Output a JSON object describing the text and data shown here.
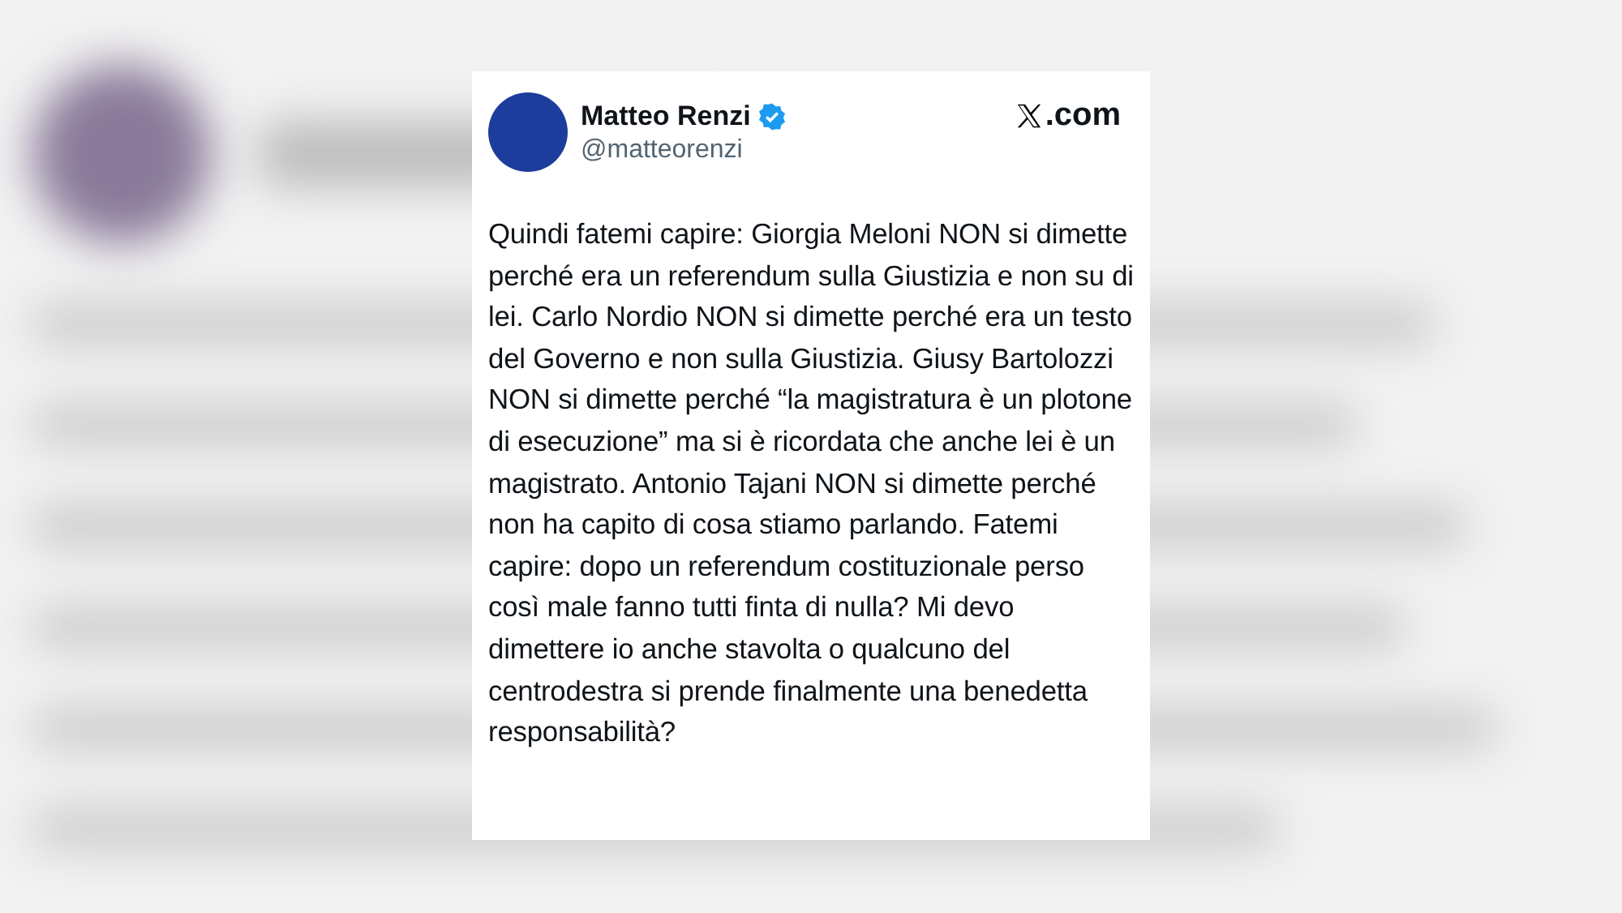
{
  "tweet": {
    "name": "Matteo Renzi",
    "verified": true,
    "handle": "@matteorenzi",
    "site": ".com",
    "text": "Quindi fatemi capire: Giorgia Meloni NON si dimette perché era un referendum sulla Giustizia e non su di lei. Carlo Nordio NON si dimette perché era un testo del Governo e non sulla Giustizia. Giusy Bartolozzi NON si dimette perché “la magistratura è un plotone di esecuzione” ma si è ricordata che anche lei è un magistrato. Antonio Tajani NON si dimette perché non ha capito di cosa stiamo parlando. Fatemi capire: dopo un referendum costituzionale perso così male fanno tutti finta di nulla? Mi devo dimettere io anche stavolta o qualcuno del centrodestra si prende finalmente una benedetta responsabilità?"
  }
}
